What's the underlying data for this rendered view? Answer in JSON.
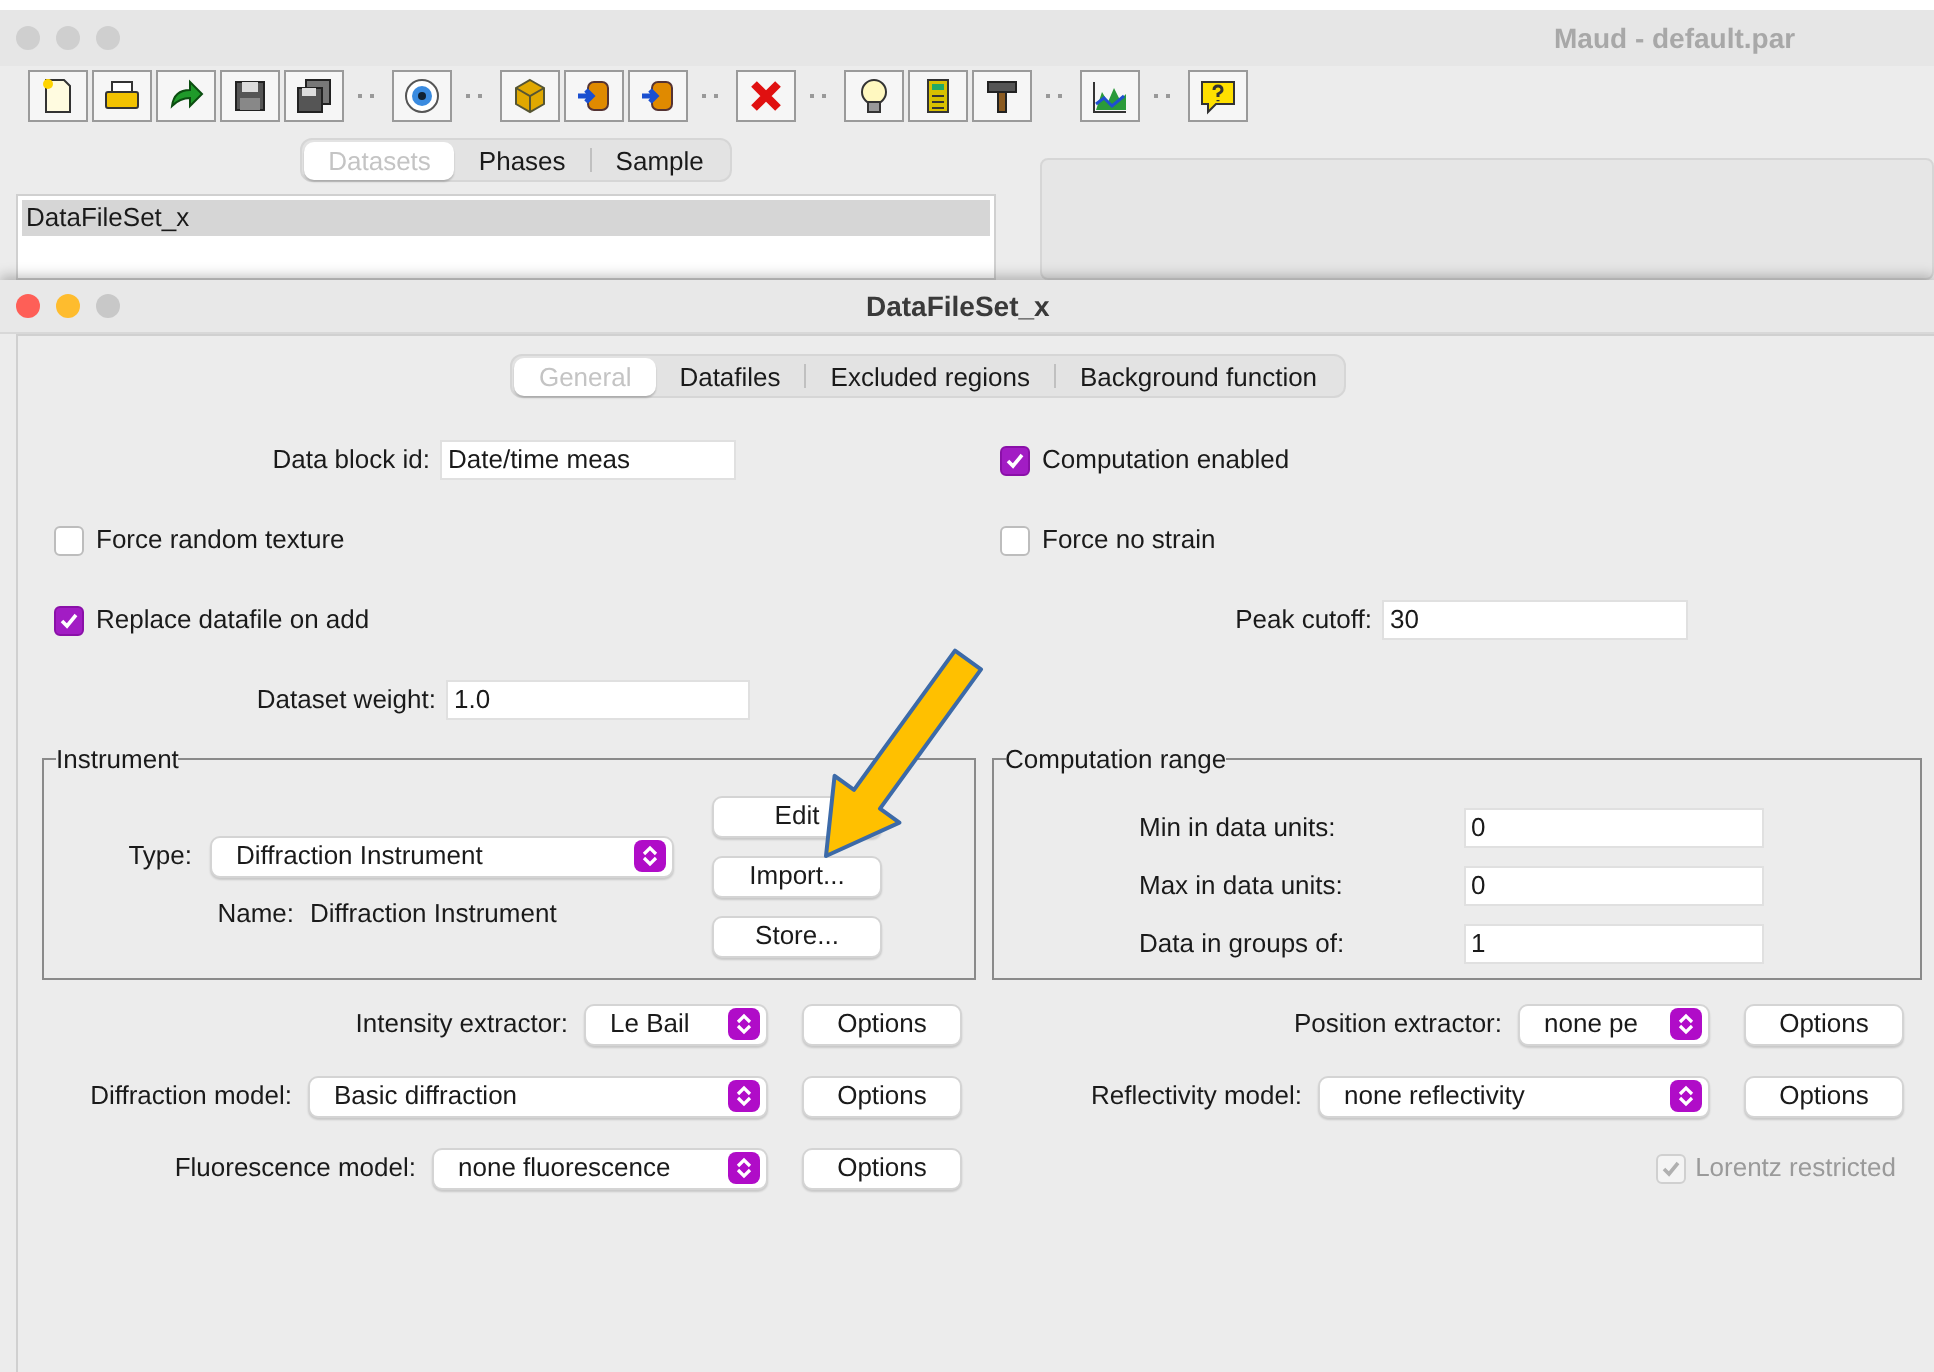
{
  "main_window": {
    "title": "Maud - default.par",
    "tabs": [
      {
        "label": "Datasets",
        "selected": true
      },
      {
        "label": "Phases",
        "selected": false
      },
      {
        "label": "Sample",
        "selected": false
      }
    ],
    "datasets": [
      {
        "label": "DataFileSet_x",
        "selected": true
      }
    ]
  },
  "dialog": {
    "title": "DataFileSet_x",
    "tabs": [
      {
        "label": "General",
        "selected": true
      },
      {
        "label": "Datafiles",
        "selected": false
      },
      {
        "label": "Excluded regions",
        "selected": false
      },
      {
        "label": "Background function",
        "selected": false
      }
    ],
    "data_block_id": {
      "label": "Data block id:",
      "value": "Date/time meas"
    },
    "computation_enabled": {
      "label": "Computation enabled",
      "checked": true
    },
    "force_random_texture": {
      "label": "Force random texture",
      "checked": false
    },
    "force_no_strain": {
      "label": "Force no strain",
      "checked": false
    },
    "replace_datafile": {
      "label": "Replace datafile on add",
      "checked": true
    },
    "peak_cutoff": {
      "label": "Peak cutoff:",
      "value": "30"
    },
    "dataset_weight": {
      "label": "Dataset weight:",
      "value": "1.0"
    },
    "instrument": {
      "title": "Instrument",
      "type_label": "Type:",
      "type_value": "Diffraction Instrument",
      "name_label": "Name:",
      "name_value": "Diffraction Instrument",
      "buttons": [
        "Edit",
        "Import...",
        "Store..."
      ]
    },
    "computation_range": {
      "title": "Computation range",
      "fields": [
        {
          "label": "Min in data units:",
          "value": "0"
        },
        {
          "label": "Max in data units:",
          "value": "0"
        },
        {
          "label": "Data in groups of:",
          "value": "1"
        }
      ]
    },
    "left_models": [
      {
        "label": "Intensity extractor:",
        "value": "Le Bail",
        "button": "Options"
      },
      {
        "label": "Diffraction model:",
        "value": "Basic diffraction",
        "button": "Options"
      },
      {
        "label": "Fluorescence model:",
        "value": "none fluorescence",
        "button": "Options"
      }
    ],
    "right_models": [
      {
        "label": "Position extractor:",
        "value": "none pe",
        "button": "Options"
      },
      {
        "label": "Reflectivity model:",
        "value": "none reflectivity",
        "button": "Options"
      }
    ],
    "lorentz_restricted": {
      "label": "Lorentz restricted",
      "checked": true,
      "disabled": true
    }
  }
}
